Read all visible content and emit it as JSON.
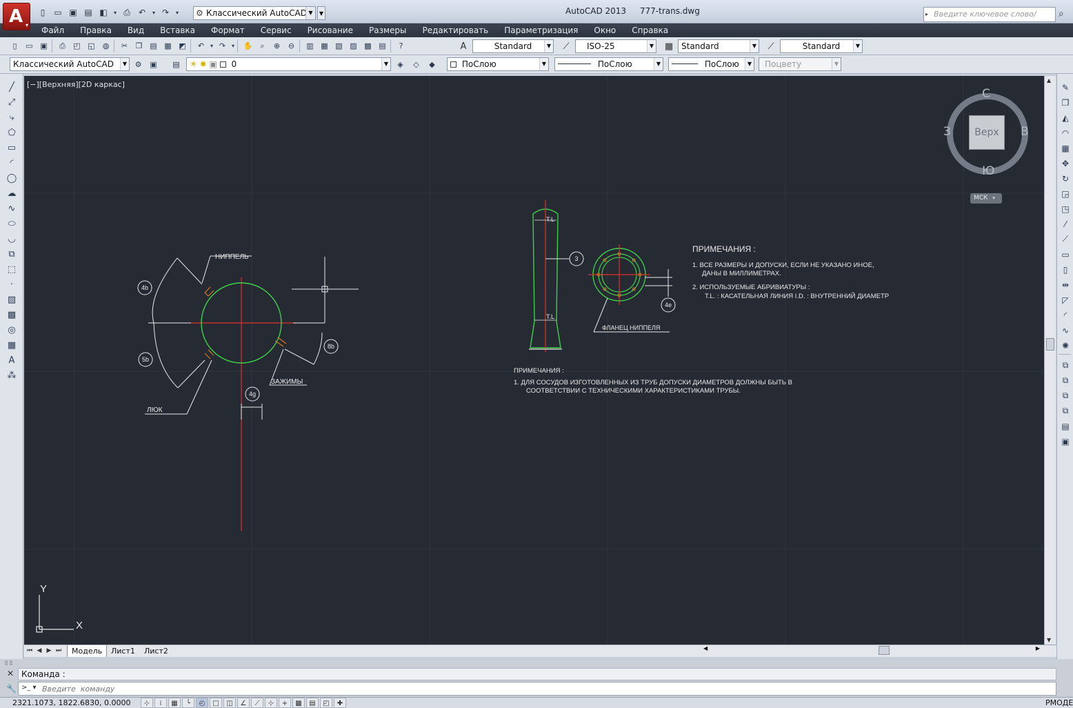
{
  "app": {
    "logo_letter": "A",
    "window_title": "AutoCAD 2013",
    "file_name": "777-trans.dwg",
    "search_placeholder": "Введите ключевое слово/фразу"
  },
  "quick_access": {
    "workspace": "Классический AutoCAD"
  },
  "menu": [
    "Файл",
    "Правка",
    "Вид",
    "Вставка",
    "Формат",
    "Сервис",
    "Рисование",
    "Размеры",
    "Редактировать",
    "Параметризация",
    "Окно",
    "Справка"
  ],
  "styles_toolbar": {
    "text_style": "Standard",
    "dim_style": "ISO-25",
    "table_style": "Standard",
    "multileader_style": "Standard"
  },
  "layers_toolbar": {
    "workspace": "Классический AutoCAD",
    "current_layer": "0",
    "color": "ПоСлою",
    "linetype": "ПоСлою",
    "lineweight": "ПоСлою",
    "plot_style": "Поцвету"
  },
  "viewport": {
    "label": "[−][Верхняя][2D каркас]"
  },
  "viewcube": {
    "top_face": "Верх",
    "north": "С",
    "south": "Ю",
    "west": "З",
    "east": "В",
    "wcs": "МСК"
  },
  "ucs": {
    "x_label": "X",
    "y_label": "Y"
  },
  "drawing": {
    "left_view": {
      "nipple_label": "НИППЕЛЬ",
      "clamps_label": "ЗАЖИМЫ",
      "manhole_label": "ЛЮК",
      "balloons": [
        "4b",
        "5b",
        "8b",
        "4g"
      ]
    },
    "right_view": {
      "tl_top": "T.L",
      "tl_bottom": "T.L",
      "balloon_3": "3",
      "balloon_4e": "4e",
      "flange_label": "ФЛАНЕЦ НИППЕЛЯ"
    },
    "notes_right": {
      "title": "ПРИМЕЧАНИЯ :",
      "line1": "1. ВСЕ РАЗМЕРЫ И ДОПУСКИ, ЕСЛИ НЕ УКАЗАНО ИНОЕ,",
      "line2": "ДАНЫ В МИЛЛИМЕТРАХ.",
      "line3": "2. ИСПОЛЬЗУЕМЫЕ АБРИВИАТУРЫ :",
      "line4": "T.L. : КАСАТЕЛЬНАЯ ЛИНИЯ     I.D. : ВНУТРЕННИЙ ДИАМЕТР"
    },
    "notes_bottom": {
      "title": "ПРИМЕЧАНИЯ :",
      "line1": "1. ДЛЯ СОСУДОВ ИЗГОТОВЛЕННЫХ ИЗ ТРУБ ДОПУСКИ ДИАМЕТРОВ ДОЛЖНЫ БЫТЬ В",
      "line2": "СООТВЕТСТВИИ С ТЕХНИЧЕСКИМИ ХАРАКТЕРИСТИКАМИ ТРУБЫ."
    }
  },
  "layout_tabs": [
    "Модель",
    "Лист1",
    "Лист2"
  ],
  "command": {
    "history": "Команда :",
    "placeholder": "Введите  команду"
  },
  "status": {
    "coords": "2321.1073, 1822.6830, 0.0000",
    "mode": "РМОДЕ"
  },
  "colors": {
    "canvas": "#252a33",
    "green": "#3fd14a",
    "red": "#e0302a",
    "white_line": "#e8e8e8"
  }
}
